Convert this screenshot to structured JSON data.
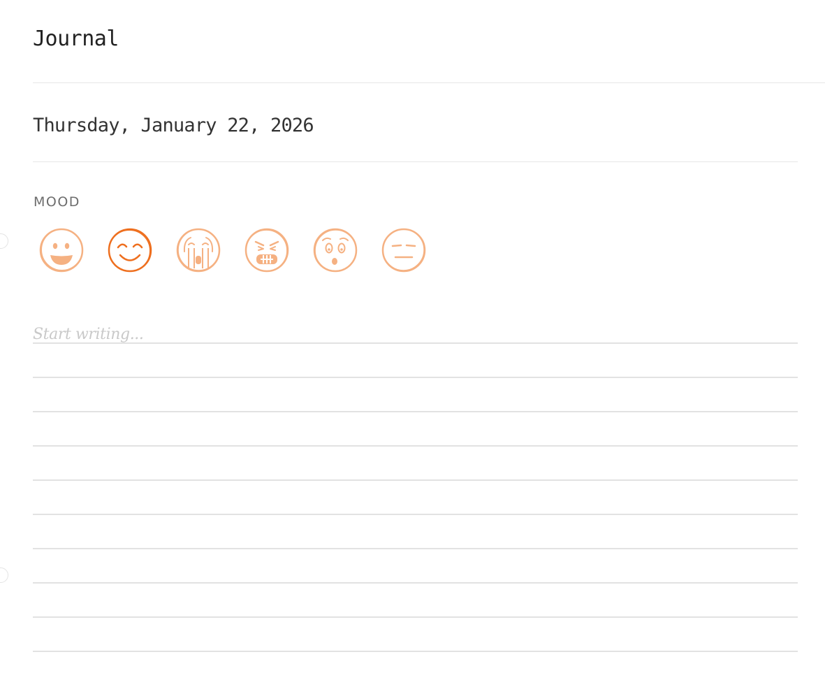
{
  "header": {
    "title": "Journal"
  },
  "entry": {
    "date": "Thursday, January 22, 2026",
    "mood_label": "MOOD",
    "placeholder": "Start writing...",
    "ruled_line_count": 10
  },
  "moods": [
    {
      "icon": "grinning-face-icon",
      "selected": false
    },
    {
      "icon": "smiling-face-icon",
      "selected": true
    },
    {
      "icon": "crying-face-icon",
      "selected": false
    },
    {
      "icon": "angry-face-icon",
      "selected": false
    },
    {
      "icon": "surprised-face-icon",
      "selected": false
    },
    {
      "icon": "expressionless-face-icon",
      "selected": false
    }
  ],
  "colors": {
    "accent": "#ee6f1f",
    "mood_inactive": "#f5b182",
    "rule": "#e2e2e2",
    "placeholder": "#c9c9c9"
  }
}
